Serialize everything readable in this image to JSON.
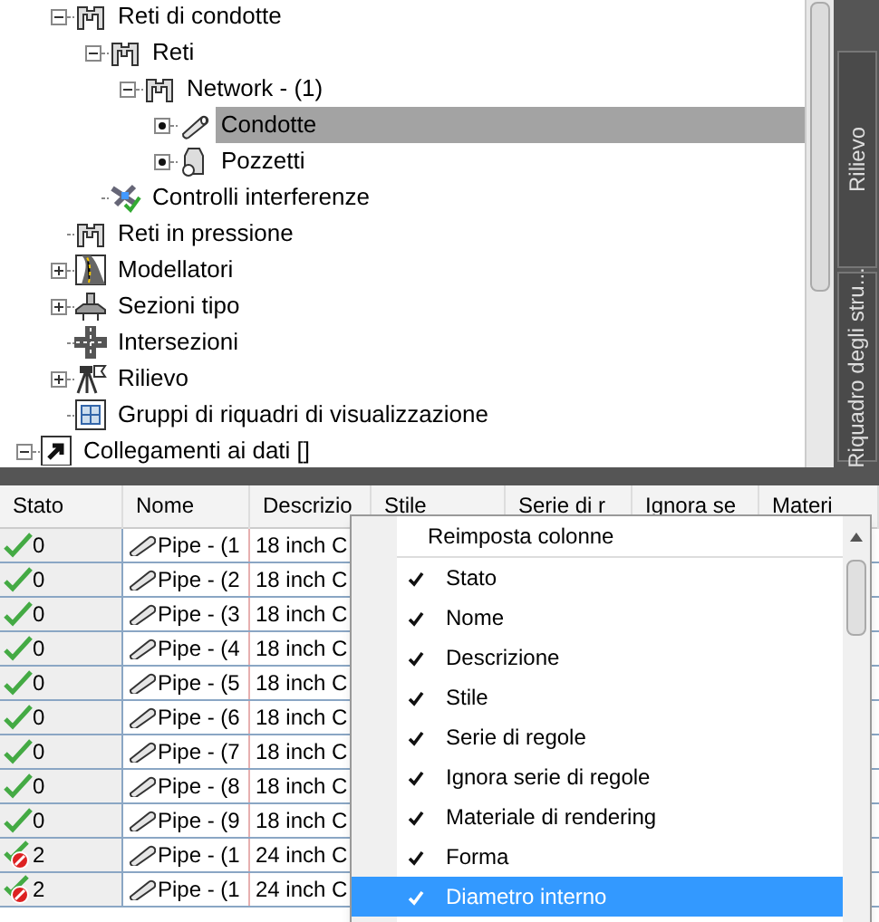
{
  "tree": [
    {
      "label": "Reti di condotte",
      "kind": "network",
      "expanded": true,
      "selected": false,
      "children": [
        {
          "label": "Reti",
          "kind": "network",
          "expanded": true,
          "selected": false,
          "children": [
            {
              "label": "Network - (1)",
              "kind": "network",
              "expanded": true,
              "selected": false,
              "children": [
                {
                  "label": "Condotte",
                  "kind": "pipe",
                  "bullet": true,
                  "selected": true
                },
                {
                  "label": "Pozzetti",
                  "kind": "structure",
                  "bullet": true,
                  "selected": false
                }
              ]
            }
          ]
        },
        {
          "label": "Controlli interferenze",
          "kind": "interference",
          "selected": false
        }
      ]
    },
    {
      "label": "Reti in pressione",
      "kind": "network",
      "selected": false
    },
    {
      "label": "Modellatori",
      "kind": "corridor",
      "expanded": false,
      "selected": false
    },
    {
      "label": "Sezioni tipo",
      "kind": "assembly",
      "expanded": false,
      "selected": false
    },
    {
      "label": "Intersezioni",
      "kind": "intersection",
      "selected": false
    },
    {
      "label": "Rilievo",
      "kind": "survey",
      "expanded": false,
      "selected": false
    },
    {
      "label": "Gruppi di riquadri di visualizzazione",
      "kind": "viewframe",
      "selected": false
    }
  ],
  "tree_after": [
    {
      "label": "Collegamenti ai dati []",
      "kind": "shortcut",
      "expanded": true,
      "selected": false
    }
  ],
  "side_tabs": [
    "Rilievo",
    "Riquadro degli stru..."
  ],
  "table": {
    "columns": [
      "Stato",
      "Nome",
      "Descrizio",
      "Stile",
      "Serie di r",
      "Ignora se",
      "Materi"
    ],
    "rows": [
      {
        "error": false,
        "stato": "0",
        "nome": "Pipe - (1",
        "descrizione": "18 inch C"
      },
      {
        "error": false,
        "stato": "0",
        "nome": "Pipe - (2",
        "descrizione": "18 inch C"
      },
      {
        "error": false,
        "stato": "0",
        "nome": "Pipe - (3",
        "descrizione": "18 inch C"
      },
      {
        "error": false,
        "stato": "0",
        "nome": "Pipe - (4",
        "descrizione": "18 inch C"
      },
      {
        "error": false,
        "stato": "0",
        "nome": "Pipe - (5",
        "descrizione": "18 inch C"
      },
      {
        "error": false,
        "stato": "0",
        "nome": "Pipe - (6",
        "descrizione": "18 inch C"
      },
      {
        "error": false,
        "stato": "0",
        "nome": "Pipe - (7",
        "descrizione": "18 inch C"
      },
      {
        "error": false,
        "stato": "0",
        "nome": "Pipe - (8",
        "descrizione": "18 inch C"
      },
      {
        "error": false,
        "stato": "0",
        "nome": "Pipe - (9",
        "descrizione": "18 inch C"
      },
      {
        "error": true,
        "stato": "2",
        "nome": "Pipe - (1",
        "descrizione": "24 inch C"
      },
      {
        "error": true,
        "stato": "2",
        "nome": "Pipe - (1",
        "descrizione": "24 inch C"
      }
    ]
  },
  "column_menu": {
    "reset": "Reimposta colonne",
    "items": [
      {
        "label": "Stato",
        "checked": true,
        "selected": false
      },
      {
        "label": "Nome",
        "checked": true,
        "selected": false
      },
      {
        "label": "Descrizione",
        "checked": true,
        "selected": false
      },
      {
        "label": "Stile",
        "checked": true,
        "selected": false
      },
      {
        "label": "Serie di regole",
        "checked": true,
        "selected": false
      },
      {
        "label": "Ignora serie di regole",
        "checked": true,
        "selected": false
      },
      {
        "label": "Materiale di rendering",
        "checked": true,
        "selected": false
      },
      {
        "label": "Forma",
        "checked": true,
        "selected": false
      },
      {
        "label": "Diametro interno",
        "checked": true,
        "selected": true
      }
    ]
  }
}
